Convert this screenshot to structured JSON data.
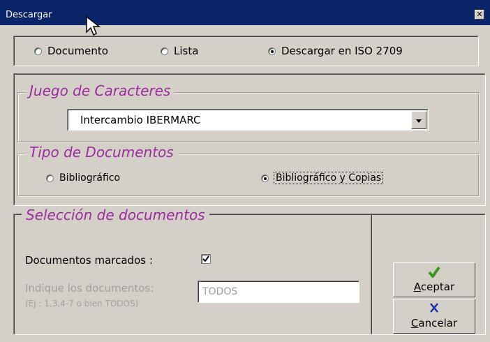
{
  "window": {
    "title": "Descargar"
  },
  "export_type": {
    "options": [
      "Documento",
      "Lista",
      "Descargar en ISO 2709"
    ],
    "selected": "Descargar en ISO 2709"
  },
  "charset": {
    "legend": "Juego de Caracteres",
    "selected": "Intercambio IBERMARC"
  },
  "doc_type": {
    "legend": "Tipo de Documentos",
    "options": [
      "Bibliográfico",
      "Bibliográfico y Copias"
    ],
    "selected": "Bibliográfico y Copias"
  },
  "selection": {
    "legend": "Selección de documentos",
    "marked_label": "Documentos marcados :",
    "marked_checked": true,
    "indicate_label": "Indique los documentos:",
    "example": "(Ej : 1,3,4-7 o bien TODOS)",
    "input_value": "TODOS"
  },
  "buttons": {
    "accept_access_key": "A",
    "accept_rest": "ceptar",
    "cancel_access_key": "C",
    "cancel_rest": "ancelar"
  },
  "colors": {
    "title_bar": "#0a246a",
    "legend_text": "#9c2ba0",
    "accept_check": "#3a9a1a",
    "cancel_x": "#1b2fae"
  },
  "icons": [
    "close-icon",
    "cursor-icon",
    "dropdown-arrow-icon",
    "checkmark-icon",
    "cancel-x-icon"
  ]
}
